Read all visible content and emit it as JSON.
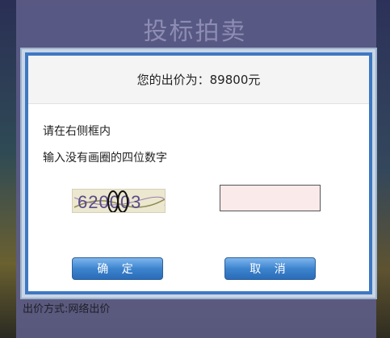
{
  "background": {
    "title": "投标拍卖",
    "footer_text": "出价方式:网络出价"
  },
  "modal": {
    "bid_label": "您的出价为：",
    "bid_value": "89800元",
    "instruction_line1": "请在右侧框内",
    "instruction_line2": "输入没有画圈的四位数字",
    "captcha_text": "620003",
    "captcha_input_value": "",
    "ok_label": "确  定",
    "cancel_label": "取  消"
  },
  "colors": {
    "accent_blue": "#3e78c2",
    "button_blue": "#3d84cf",
    "input_bg": "#fbeaea"
  }
}
